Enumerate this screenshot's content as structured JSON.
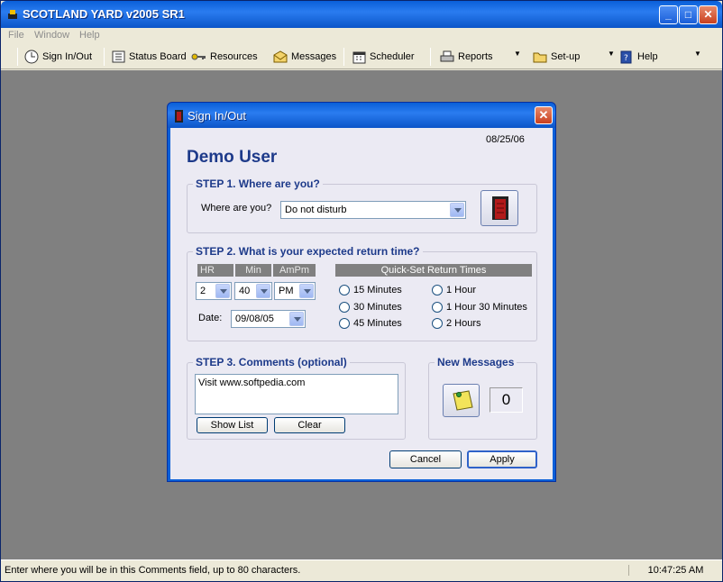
{
  "app": {
    "title": "SCOTLAND YARD v2005 SR1"
  },
  "menu": {
    "file": "File",
    "window": "Window",
    "help": "Help"
  },
  "toolbar": {
    "signin": "Sign In/Out",
    "status_board": "Status Board",
    "resources": "Resources",
    "messages": "Messages",
    "scheduler": "Scheduler",
    "reports": "Reports",
    "setup": "Set-up",
    "help": "Help"
  },
  "dialog": {
    "title": "Sign In/Out",
    "date": "08/25/06",
    "user": "Demo User",
    "step1": {
      "title": "STEP 1.  Where are you?",
      "label": "Where are you?",
      "value": "Do not disturb"
    },
    "step2": {
      "title": "STEP 2.  What is your expected return time?",
      "hr_header": "HR",
      "min_header": "Min",
      "ampm_header": "AmPm",
      "hr_value": "2",
      "min_value": "40",
      "ampm_value": "PM",
      "date_label": "Date:",
      "date_value": "09/08/05",
      "quickset_header": "Quick-Set Return Times",
      "quick": [
        "15 Minutes",
        "30 Minutes",
        "45 Minutes",
        "1 Hour",
        "1 Hour 30 Minutes",
        "2 Hours"
      ]
    },
    "step3": {
      "title": "STEP 3.  Comments  (optional)",
      "comment": "Visit www.softpedia.com",
      "show_list": "Show List",
      "clear": "Clear"
    },
    "new_messages": {
      "title": "New Messages",
      "count": "0"
    },
    "cancel": "Cancel",
    "apply": "Apply"
  },
  "status": {
    "message": "Enter where you will be in this Comments field, up to 80 characters.",
    "clock": "10:47:25 AM"
  }
}
